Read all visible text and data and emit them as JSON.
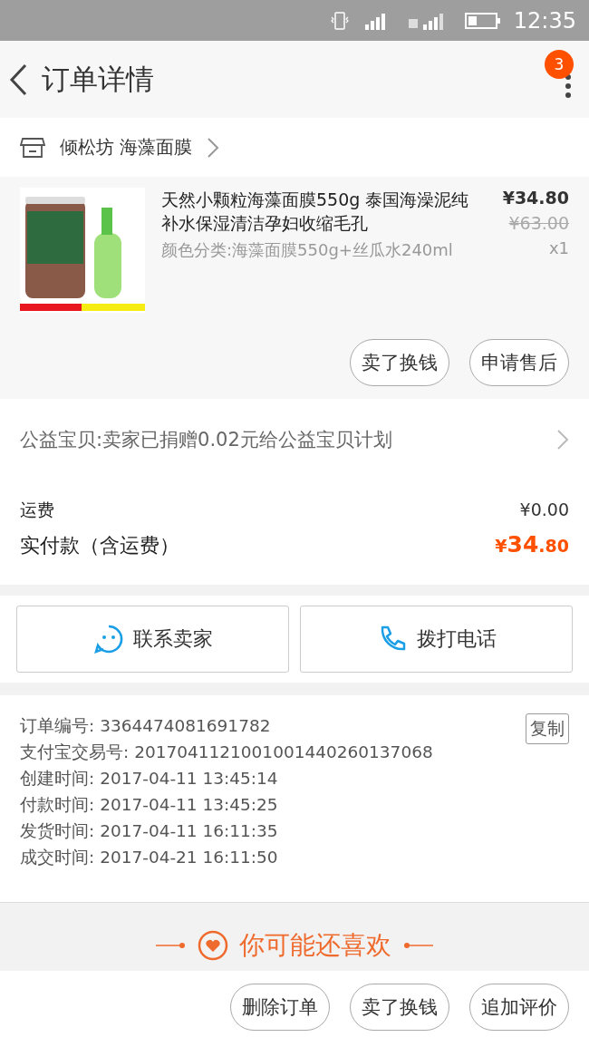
{
  "status_bar": {
    "time": "12:35"
  },
  "header": {
    "title": "订单详情",
    "badge": "3"
  },
  "shop": {
    "name": "倾松坊 海藻面膜"
  },
  "product": {
    "image": {
      "kind": "picture"
    },
    "title": "天然小颗粒海藻面膜550g 泰国海澡泥纯补水保湿清洁孕妇收缩毛孔",
    "variant": "颜色分类:海藻面膜550g+丝瓜水240ml",
    "price": "¥34.80",
    "original_price": "¥63.00",
    "quantity": "x1",
    "buttons": [
      "卖了换钱",
      "申请售后"
    ]
  },
  "charity": {
    "text": "公益宝贝:卖家已捐赠0.02元给公益宝贝计划"
  },
  "fees": {
    "shipping_label": "运费",
    "shipping_value": "¥0.00",
    "total_label": "实付款（含运费）",
    "total_currency": "¥",
    "total_integer": "34",
    "total_decimal": ".80"
  },
  "contact_buttons": [
    {
      "kind": "chat",
      "label": "联系卖家"
    },
    {
      "kind": "phone",
      "label": "拨打电话"
    }
  ],
  "order_info": {
    "copy_button": "复制",
    "lines": [
      {
        "label": "订单编号:",
        "value": "3364474081691782"
      },
      {
        "label": "支付宝交易号:",
        "value": "2017041121001001440260137068"
      },
      {
        "label": "创建时间:",
        "value": "2017-04-11 13:45:14"
      },
      {
        "label": "付款时间:",
        "value": "2017-04-11 13:45:25"
      },
      {
        "label": "发货时间:",
        "value": "2017-04-11 16:11:35"
      },
      {
        "label": "成交时间:",
        "value": "2017-04-21 16:11:50"
      }
    ]
  },
  "recommend": {
    "title": "你可能还喜欢"
  },
  "bottom_buttons": [
    "删除订单",
    "卖了换钱",
    "追加评价"
  ]
}
